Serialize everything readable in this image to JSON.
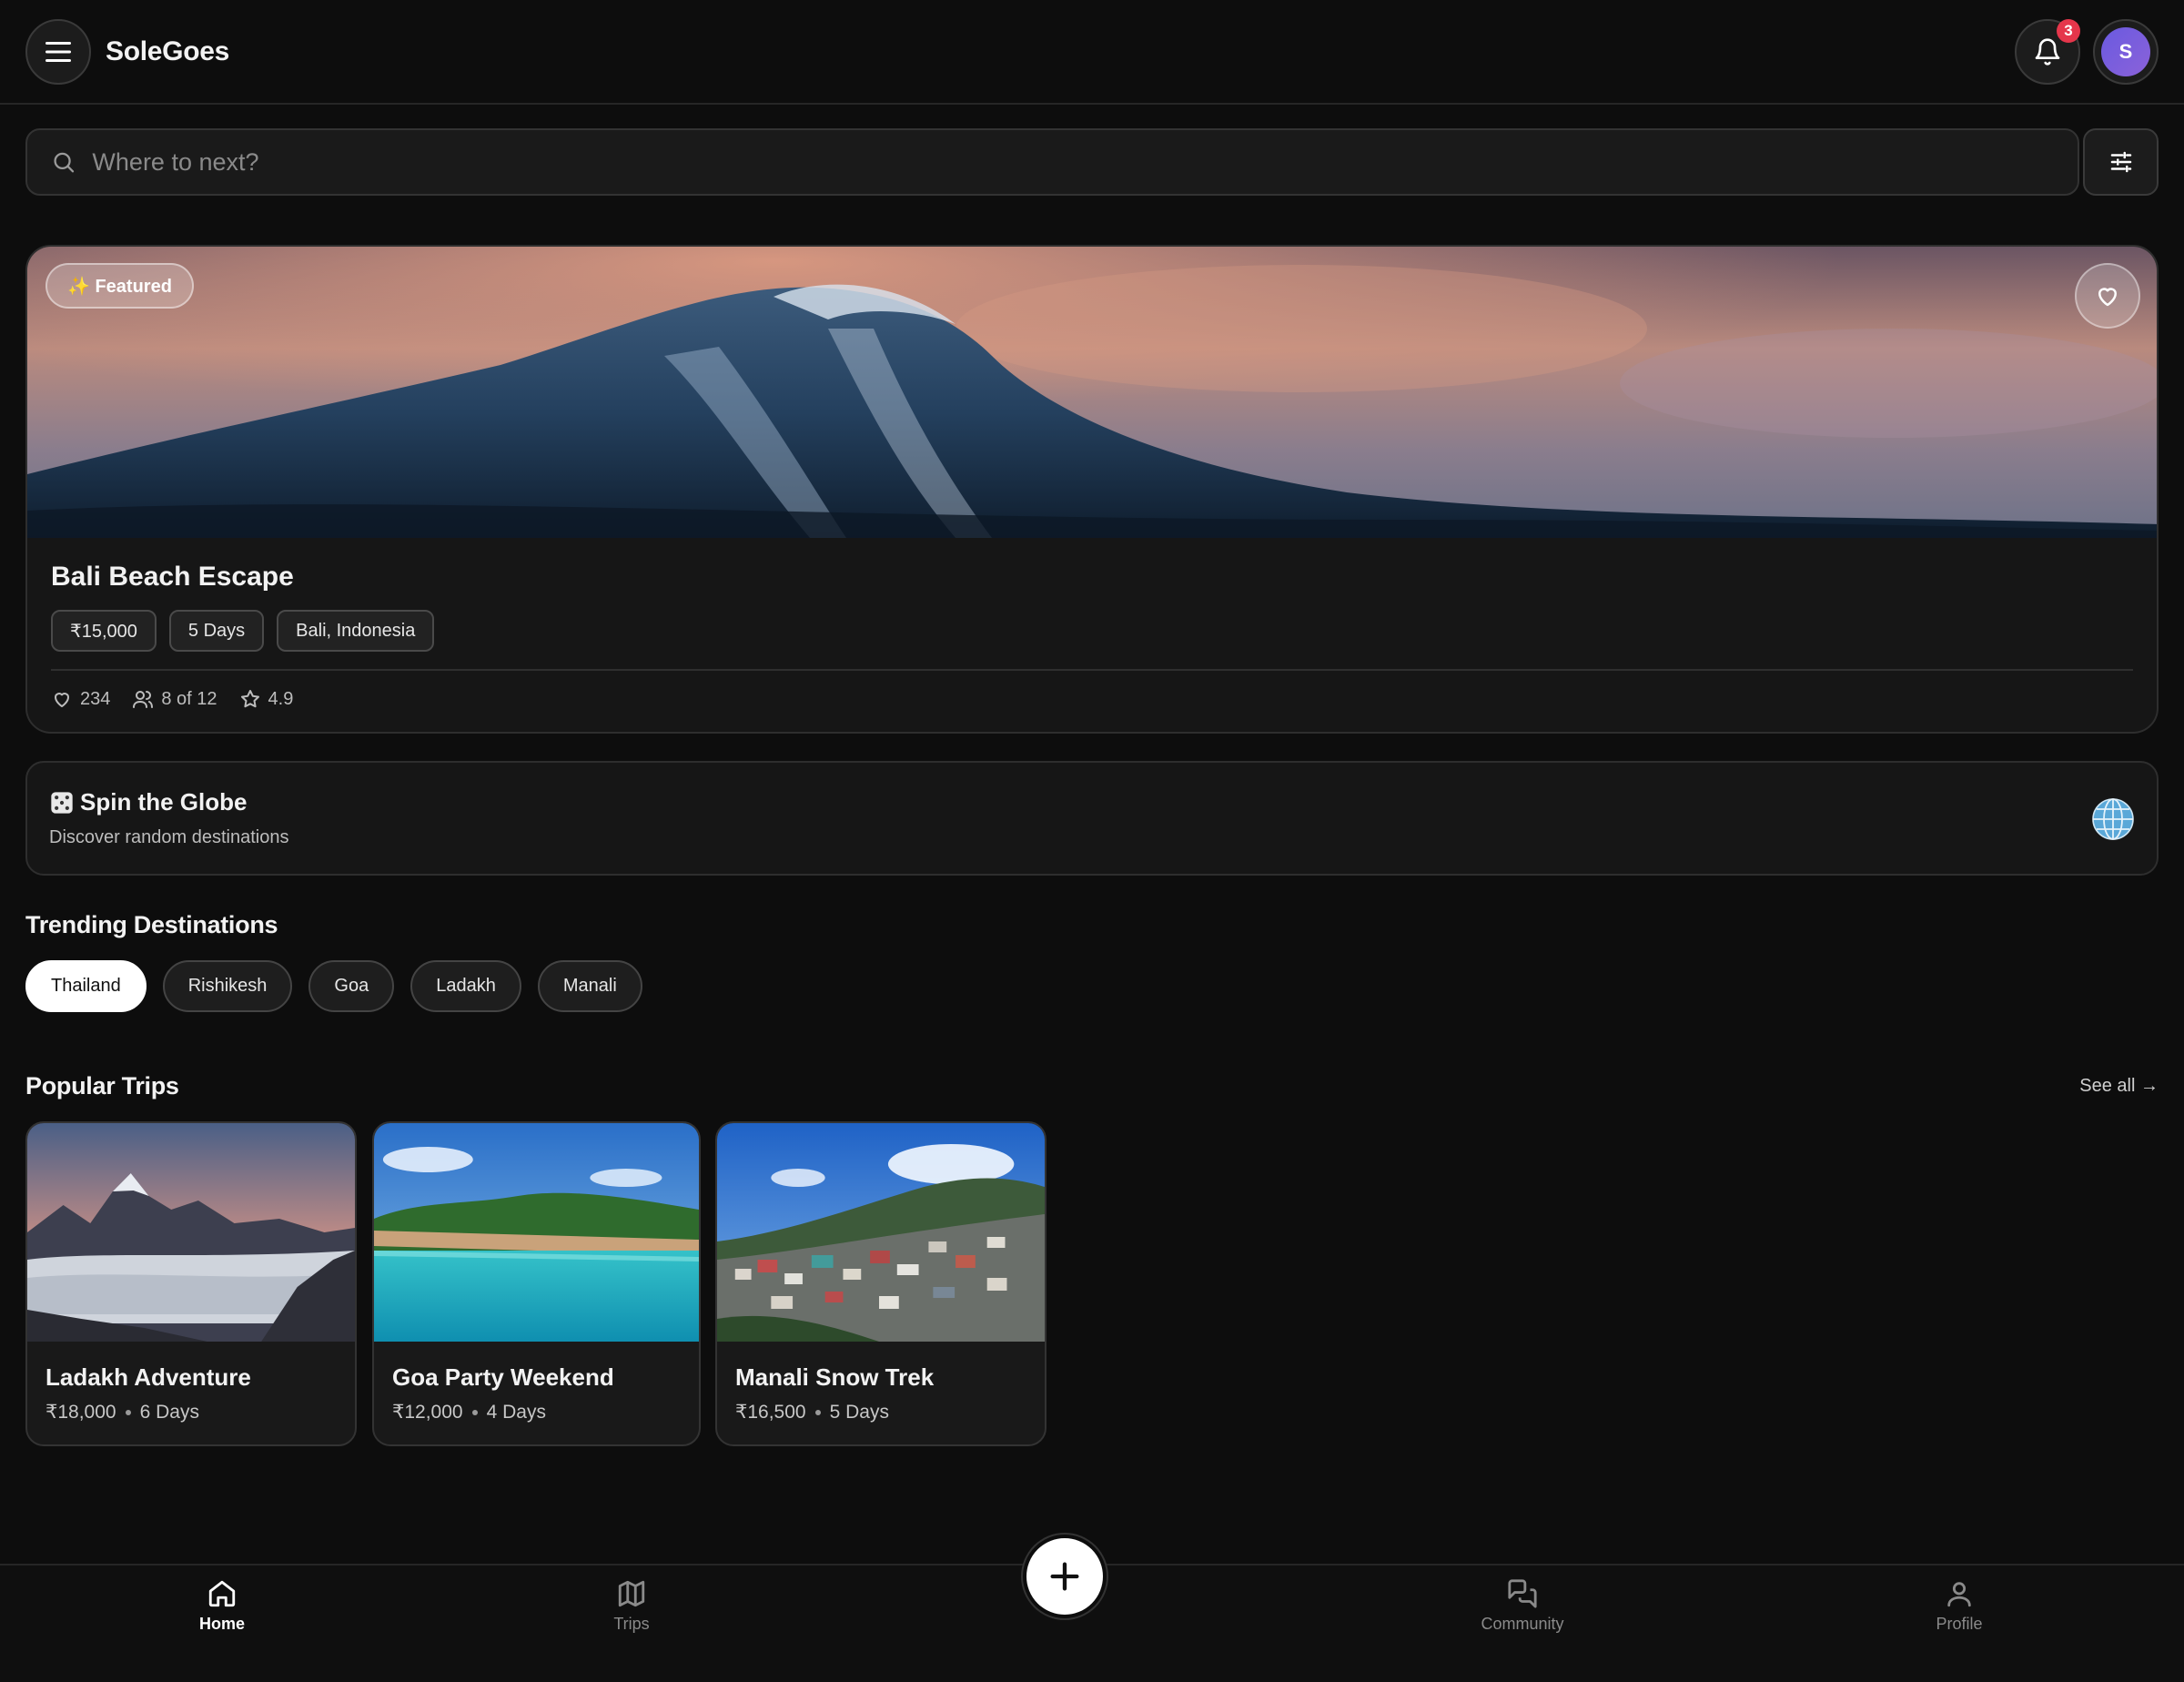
{
  "header": {
    "brand": "SoleGoes",
    "notification_count": "3",
    "avatar_initial": "S"
  },
  "search": {
    "placeholder": "Where to next?"
  },
  "featured": {
    "badge": "✨ Featured",
    "title": "Bali Beach Escape",
    "tags": [
      "₹15,000",
      "5 Days",
      "Bali, Indonesia"
    ],
    "likes": "234",
    "participants": "8 of 12",
    "rating": "4.9"
  },
  "spin": {
    "title": "Spin the Globe",
    "subtitle": "Discover random destinations"
  },
  "trending": {
    "title": "Trending Destinations",
    "items": [
      "Thailand",
      "Rishikesh",
      "Goa",
      "Ladakh",
      "Manali"
    ],
    "active": "Thailand"
  },
  "popular": {
    "title": "Popular Trips",
    "see_all": "See all →",
    "trips": [
      {
        "title": "Ladakh Adventure",
        "price": "₹18,000",
        "duration": "6 Days"
      },
      {
        "title": "Goa Party Weekend",
        "price": "₹12,000",
        "duration": "4 Days"
      },
      {
        "title": "Manali Snow Trek",
        "price": "₹16,500",
        "duration": "5 Days"
      }
    ]
  },
  "nav": {
    "home": "Home",
    "trips": "Trips",
    "community": "Community",
    "profile": "Profile"
  },
  "colors": {
    "background": "#0d0d0d",
    "card": "#161616",
    "badge": "#e5364b",
    "avatar": "#6a5ae0"
  }
}
